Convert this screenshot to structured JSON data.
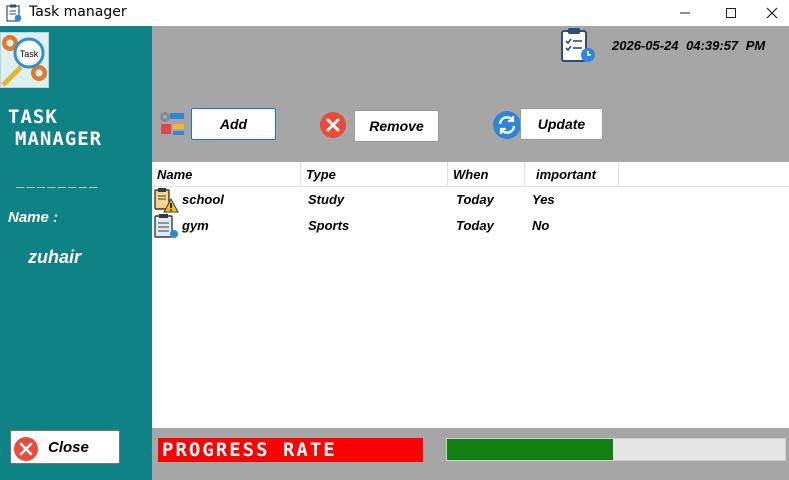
{
  "window": {
    "title": "Task manager",
    "controls": {
      "minimize": "—",
      "maximize": "☐",
      "close": "✕"
    }
  },
  "sidebar": {
    "logo_text": "Task",
    "brand_line1": "TASK",
    "brand_line2": "MANAGER",
    "divider": "________",
    "name_label": "Name :",
    "name_value": "zuhair",
    "close_label": "Close"
  },
  "header": {
    "datetime": "2026-05-24  04:39:57 PM",
    "add_label": "Add",
    "remove_label": "Remove",
    "update_label": "Update"
  },
  "table": {
    "columns": [
      "Name",
      "Type",
      "When",
      "important"
    ],
    "rows": [
      {
        "name": "school",
        "type": "Study",
        "when": "Today",
        "important": "Yes",
        "icon": "clipboard-warning-icon"
      },
      {
        "name": "gym",
        "type": "Sports",
        "when": "Today",
        "important": "No",
        "icon": "clipboard-list-icon"
      }
    ]
  },
  "footer": {
    "progress_label": "PROGRESS RATE",
    "progress_fraction": 0.49
  },
  "colors": {
    "sidebar": "#0e8285",
    "panel_gray": "#a6a6a6",
    "progress_label_bg": "#ff0000",
    "progress_fill": "#138013"
  }
}
